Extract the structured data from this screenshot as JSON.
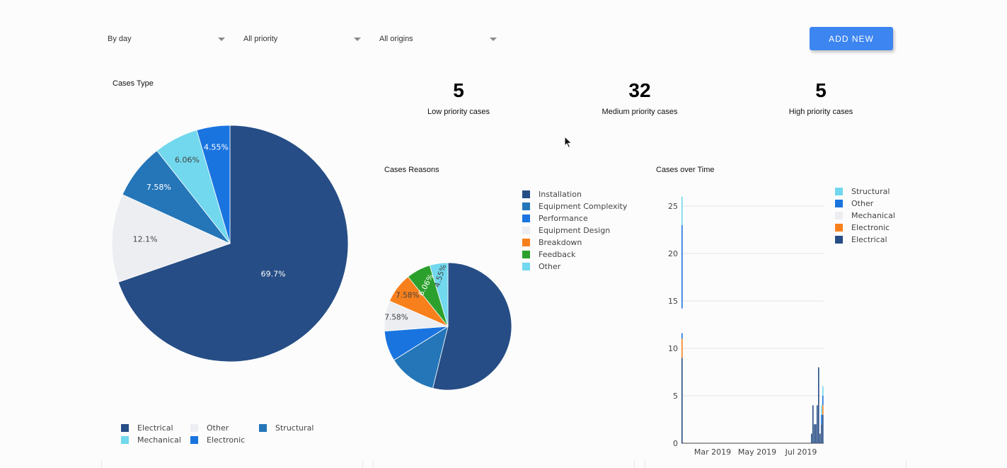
{
  "filters": {
    "period": "By day",
    "priority": "All priority",
    "origin": "All origins"
  },
  "add_button": "ADD NEW",
  "stats": [
    {
      "value": "5",
      "label": "Low priority cases"
    },
    {
      "value": "32",
      "label": "Medium priority cases"
    },
    {
      "value": "5",
      "label": "High priority cases"
    }
  ],
  "colors": {
    "electrical": "#264d85",
    "structural": "#2476b8",
    "mechanical": "#eceef2",
    "electronic": "#1a74e0",
    "other_light": "#71d8ee",
    "breakdown": "#f8801c",
    "feedback": "#2ca02c",
    "accent": "#3d85f0"
  },
  "chart_data": [
    {
      "type": "pie",
      "title": "Cases Type",
      "labels": [
        "Electrical",
        "Other",
        "Structural",
        "Mechanical",
        "Electronic"
      ],
      "values": [
        69.7,
        12.1,
        7.58,
        6.06,
        4.55
      ],
      "value_labels": [
        "69.7%",
        "12.1%",
        "7.58%",
        "6.06%",
        "4.55%"
      ],
      "legend": [
        "Electrical",
        "Other",
        "Structural",
        "Mechanical",
        "Electronic"
      ],
      "legend_position": "bottom"
    },
    {
      "type": "pie",
      "title": "Cases Reasons",
      "labels": [
        "Installation",
        "Equipment Complexity",
        "Performance",
        "Equipment Design",
        "Breakdown",
        "Feedback",
        "Other"
      ],
      "values": [
        53.0,
        12.1,
        7.58,
        7.58,
        7.58,
        6.06,
        4.55
      ],
      "value_labels": [
        "",
        "",
        "",
        "7.58%",
        "7.58%",
        "6.06%",
        "4.55%"
      ],
      "legend": [
        "Installation",
        "Equipment Complexity",
        "Performance",
        "Equipment Design",
        "Breakdown",
        "Feedback",
        "Other"
      ],
      "legend_position": "right"
    },
    {
      "type": "bar",
      "stacked": true,
      "title": "Cases over Time",
      "series_names": [
        "Structural",
        "Other",
        "Mechanical",
        "Electronic",
        "Electrical"
      ],
      "y_ticks": [
        "0",
        "5",
        "10",
        "15",
        "20",
        "25"
      ],
      "x_ticks": [
        "Mar 2019",
        "May 2019",
        "Jul 2019"
      ],
      "y_range": [
        0,
        26
      ],
      "grid": true,
      "legend_position": "right"
    }
  ]
}
